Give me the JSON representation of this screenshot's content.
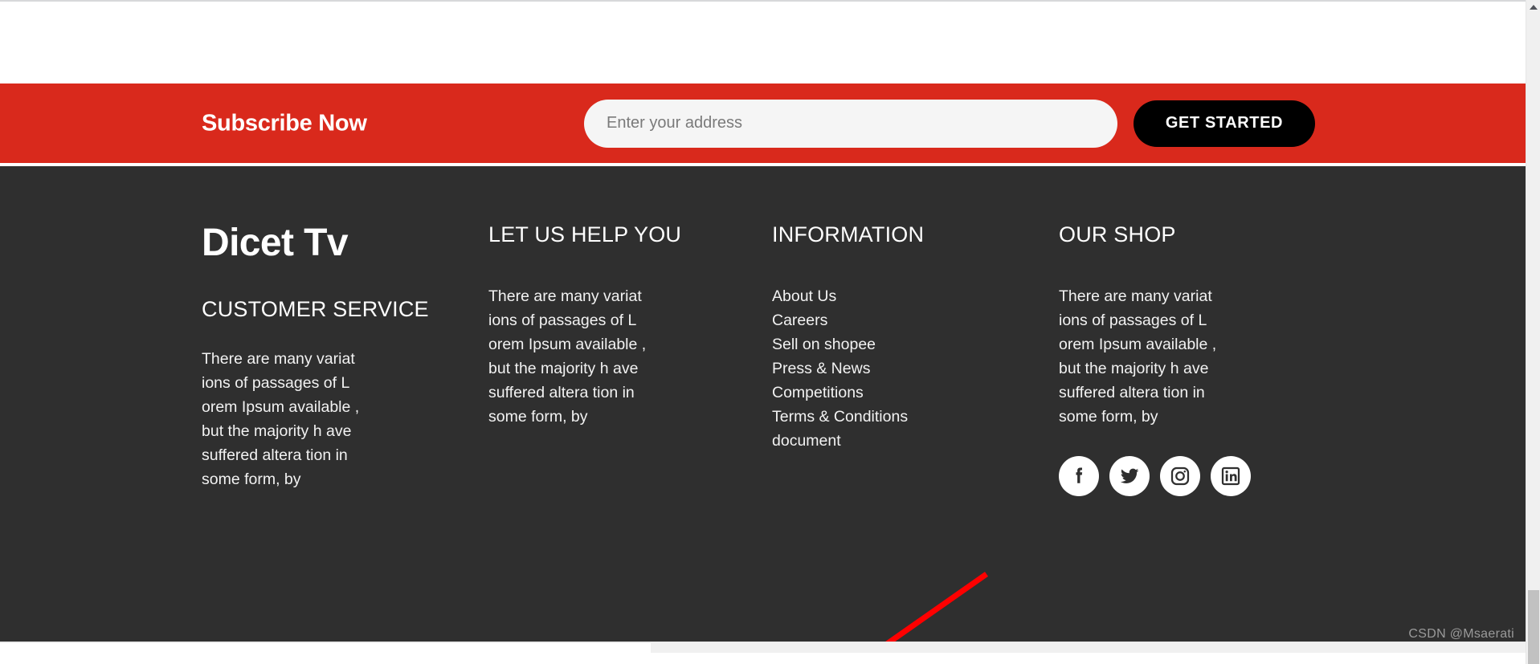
{
  "subscribe": {
    "title": "Subscribe Now",
    "input_placeholder": "Enter your address",
    "input_value": "",
    "cta_label": "GET STARTED",
    "band_color": "#d9291c",
    "cta_color": "#000000"
  },
  "footer": {
    "background_color": "#2f2f2f",
    "brand": {
      "logo": "Dicet Tv",
      "heading": "CUSTOMER SERVICE",
      "body": "There are many variat\nions of passages of L\norem Ipsum available ,\nbut the majority h ave\nsuffered altera tion in\nsome form, by"
    },
    "help": {
      "heading": "LET US HELP YOU",
      "body": "There are many variat\nions of passages of L\norem Ipsum available ,\nbut the majority h ave\nsuffered altera tion in\nsome form, by"
    },
    "information": {
      "heading": "INFORMATION",
      "links": [
        {
          "label": "About Us"
        },
        {
          "label": "Careers"
        },
        {
          "label": "Sell on shopee"
        },
        {
          "label": "Press & News"
        },
        {
          "label": "Competitions"
        },
        {
          "label": "Terms & Conditions"
        },
        {
          "label": "document"
        }
      ]
    },
    "shop": {
      "heading": "OUR SHOP",
      "body": "There are many variat\nions of passages of L\norem Ipsum available ,\nbut the majority h ave\nsuffered altera tion in\nsome form, by",
      "social": [
        {
          "name": "facebook-icon"
        },
        {
          "name": "twitter-icon"
        },
        {
          "name": "instagram-icon"
        },
        {
          "name": "linkedin-icon"
        }
      ]
    }
  },
  "annotation": {
    "arrow_color": "#ff0000",
    "points_to": "document"
  },
  "watermark": {
    "text": "CSDN @Msaerati"
  }
}
